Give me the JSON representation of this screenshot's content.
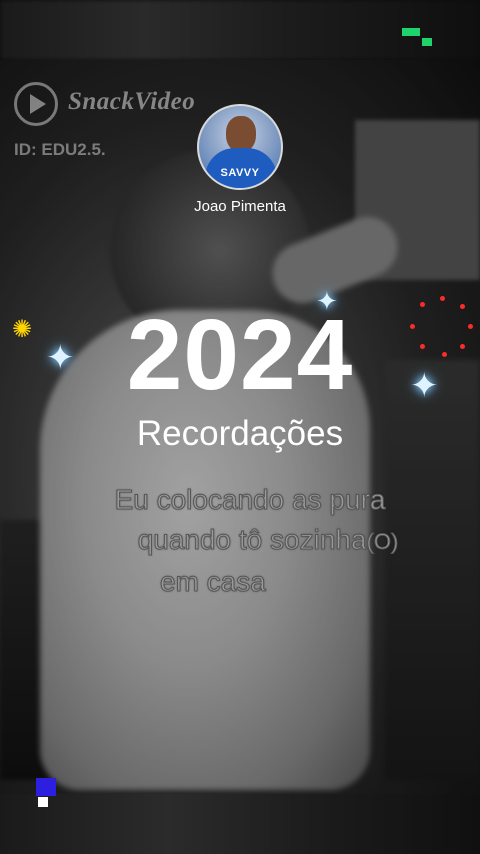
{
  "watermark": {
    "brand": "SnackVideo",
    "id_label": "ID: EDU2.5."
  },
  "creator": {
    "username": "Joao Pimenta",
    "avatar_sponsor": "SAVVY"
  },
  "overlay": {
    "year": "2024",
    "subtitle": "Recordações"
  },
  "caption": {
    "line1": "Eu colocando as pura",
    "line2_main": "quando tô sozinha",
    "line2_suffix": "(O)",
    "line3": "em casa"
  },
  "icons": [
    "sparkle-icon",
    "sun-icon"
  ],
  "colors": {
    "sparkle": "#dff2ff",
    "sun": "#ffd400",
    "dots": "#ff2a2a",
    "indicator_green": "#1fd36b",
    "indicator_blue": "#2d1fe0"
  }
}
